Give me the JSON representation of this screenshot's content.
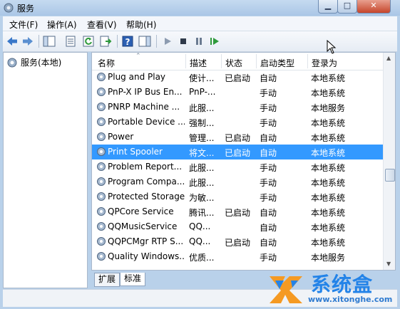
{
  "window": {
    "title": "服务"
  },
  "menu": [
    "文件(F)",
    "操作(A)",
    "查看(V)",
    "帮助(H)"
  ],
  "tree": {
    "root_label": "服务(本地)"
  },
  "columns": {
    "name": "名称",
    "desc": "描述",
    "status": "状态",
    "startup": "启动类型",
    "logon": "登录为"
  },
  "services": [
    {
      "name": "Plug and Play",
      "desc": "使计...",
      "status": "已启动",
      "startup": "自动",
      "logon": "本地系统"
    },
    {
      "name": "PnP-X IP Bus En...",
      "desc": "PnP-...",
      "status": "",
      "startup": "手动",
      "logon": "本地系统"
    },
    {
      "name": "PNRP Machine ...",
      "desc": "此服...",
      "status": "",
      "startup": "手动",
      "logon": "本地服务"
    },
    {
      "name": "Portable Device ...",
      "desc": "强制...",
      "status": "",
      "startup": "手动",
      "logon": "本地系统"
    },
    {
      "name": "Power",
      "desc": "管理...",
      "status": "已启动",
      "startup": "自动",
      "logon": "本地系统"
    },
    {
      "name": "Print Spooler",
      "desc": "将文...",
      "status": "已启动",
      "startup": "自动",
      "logon": "本地系统",
      "selected": true
    },
    {
      "name": "Problem Report...",
      "desc": "此服...",
      "status": "",
      "startup": "手动",
      "logon": "本地系统"
    },
    {
      "name": "Program Compa...",
      "desc": "此服...",
      "status": "",
      "startup": "手动",
      "logon": "本地系统"
    },
    {
      "name": "Protected Storage",
      "desc": "为敏...",
      "status": "",
      "startup": "手动",
      "logon": "本地系统"
    },
    {
      "name": "QPCore Service",
      "desc": "腾讯...",
      "status": "已启动",
      "startup": "自动",
      "logon": "本地系统"
    },
    {
      "name": "QQMusicService",
      "desc": "QQ...",
      "status": "",
      "startup": "自动",
      "logon": "本地系统"
    },
    {
      "name": "QQPCMgr RTP S...",
      "desc": "QQ...",
      "status": "已启动",
      "startup": "自动",
      "logon": "本地系统"
    },
    {
      "name": "Quality Windows...",
      "desc": "优质...",
      "status": "",
      "startup": "手动",
      "logon": "本地服务"
    }
  ],
  "tabs": [
    "扩展",
    "标准"
  ],
  "watermark": {
    "text": "系统盒",
    "url": "www.xitonghe.com"
  },
  "colors": {
    "selection": "#3399ff",
    "chrome": "#b9d1ea",
    "watermark": "#2383e8"
  },
  "icons": {
    "back": "back-arrow-icon",
    "forward": "forward-arrow-icon",
    "play": "play-icon",
    "stop": "stop-icon",
    "pause": "pause-icon",
    "restart": "restart-icon",
    "service": "gear-icon"
  }
}
